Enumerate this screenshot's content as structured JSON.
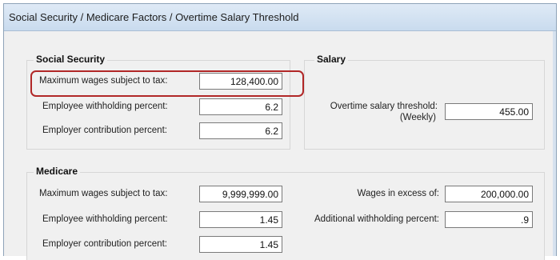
{
  "window": {
    "title": "Social Security / Medicare Factors / Overtime Salary Threshold"
  },
  "social_security": {
    "title": "Social Security",
    "max_wages_label": "Maximum wages subject to tax:",
    "max_wages_value": "128,400.00",
    "emp_withholding_label": "Employee withholding percent:",
    "emp_withholding_value": "6.2",
    "employer_contrib_label": "Employer contribution percent:",
    "employer_contrib_value": "6.2"
  },
  "salary": {
    "title": "Salary",
    "overtime_label_line1": "Overtime salary threshold:",
    "overtime_label_line2": "(Weekly)",
    "overtime_value": "455.00"
  },
  "medicare": {
    "title": "Medicare",
    "max_wages_label": "Maximum wages subject to tax:",
    "max_wages_value": "9,999,999.00",
    "emp_withholding_label": "Employee withholding percent:",
    "emp_withholding_value": "1.45",
    "employer_contrib_label": "Employer contribution percent:",
    "employer_contrib_value": "1.45",
    "wages_excess_label": "Wages in excess of:",
    "wages_excess_value": "200,000.00",
    "additional_withholding_label": "Additional withholding percent:",
    "additional_withholding_value": ".9"
  },
  "colors": {
    "highlight": "#b12727",
    "titlebar": "#c9dbee"
  }
}
